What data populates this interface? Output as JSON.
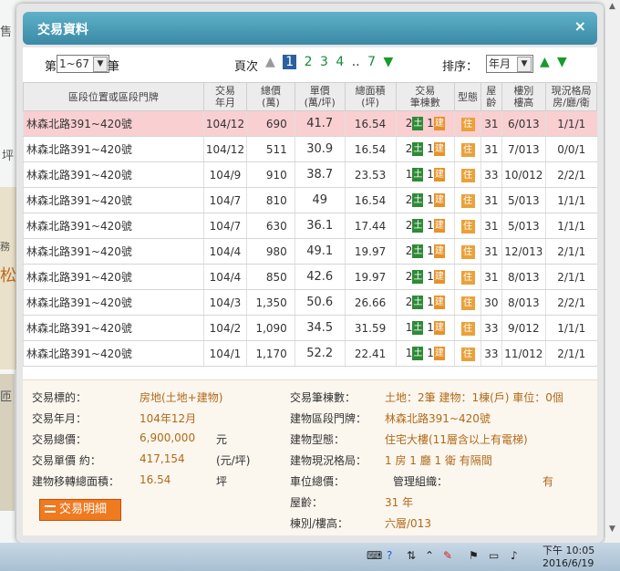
{
  "dialog": {
    "title": "交易資料",
    "close_symbol": "×"
  },
  "background": {
    "frag1": "售",
    "frag2": "坪",
    "frag3": "松",
    "frag4": "務",
    "frag5": "匝"
  },
  "controls": {
    "page_prefix": "第",
    "page_range": "1~67",
    "page_suffix": "筆",
    "pages_label": "頁次",
    "pages": [
      "1",
      "2",
      "3",
      "4"
    ],
    "ellipsis": "..",
    "last_page": "7",
    "sort_label": "排序：",
    "sort_value": "年月"
  },
  "table": {
    "headers": {
      "addr": "區段位置或區段門牌",
      "ym": [
        "交易",
        "年月"
      ],
      "total": [
        "總價",
        "(萬)"
      ],
      "unit": [
        "單價",
        "(萬/坪)"
      ],
      "area": [
        "總面積",
        "(坪)"
      ],
      "count": [
        "交易",
        "筆棟數"
      ],
      "type": "型態",
      "age": [
        "屋",
        "齡"
      ],
      "floor": [
        "樓別",
        "樓高"
      ],
      "layout": [
        "現況格局",
        "房/廳/衛"
      ]
    },
    "tags": {
      "land": "土",
      "building": "建",
      "residential": "住"
    },
    "rows": [
      {
        "addr": "林森北路391~420號",
        "ym": "104/12",
        "total": "690",
        "unit": "41.7",
        "area": "16.54",
        "land": "2",
        "bld": "1",
        "age": "31",
        "floor": "6/013",
        "layout": "1/1/1",
        "highlight": true
      },
      {
        "addr": "林森北路391~420號",
        "ym": "104/12",
        "total": "511",
        "unit": "30.9",
        "area": "16.54",
        "land": "2",
        "bld": "1",
        "age": "31",
        "floor": "7/013",
        "layout": "0/0/1"
      },
      {
        "addr": "林森北路391~420號",
        "ym": "104/9",
        "total": "910",
        "unit": "38.7",
        "area": "23.53",
        "land": "1",
        "bld": "1",
        "age": "33",
        "floor": "10/012",
        "layout": "2/2/1"
      },
      {
        "addr": "林森北路391~420號",
        "ym": "104/7",
        "total": "810",
        "unit": "49",
        "area": "16.54",
        "land": "2",
        "bld": "1",
        "age": "31",
        "floor": "5/013",
        "layout": "1/1/1"
      },
      {
        "addr": "林森北路391~420號",
        "ym": "104/7",
        "total": "630",
        "unit": "36.1",
        "area": "17.44",
        "land": "2",
        "bld": "1",
        "age": "31",
        "floor": "5/013",
        "layout": "1/1/1"
      },
      {
        "addr": "林森北路391~420號",
        "ym": "104/4",
        "total": "980",
        "unit": "49.1",
        "area": "19.97",
        "land": "2",
        "bld": "1",
        "age": "31",
        "floor": "12/013",
        "layout": "2/1/1"
      },
      {
        "addr": "林森北路391~420號",
        "ym": "104/4",
        "total": "850",
        "unit": "42.6",
        "area": "19.97",
        "land": "2",
        "bld": "1",
        "age": "31",
        "floor": "8/013",
        "layout": "2/1/1"
      },
      {
        "addr": "林森北路391~420號",
        "ym": "104/3",
        "total": "1,350",
        "unit": "50.6",
        "area": "26.66",
        "land": "2",
        "bld": "1",
        "age": "30",
        "floor": "8/013",
        "layout": "2/2/1"
      },
      {
        "addr": "林森北路391~420號",
        "ym": "104/2",
        "total": "1,090",
        "unit": "34.5",
        "area": "31.59",
        "land": "1",
        "bld": "1",
        "age": "33",
        "floor": "9/012",
        "layout": "1/1/1"
      },
      {
        "addr": "林森北路391~420號",
        "ym": "104/1",
        "total": "1,170",
        "unit": "52.2",
        "area": "22.41",
        "land": "1",
        "bld": "1",
        "age": "33",
        "floor": "11/012",
        "layout": "2/1/1"
      }
    ]
  },
  "detail": {
    "target_label": "交易標的：",
    "target_value": "房地(土地+建物)",
    "ym_label": "交易年月：",
    "ym_value": "104年12月",
    "total_label": "交易總價：",
    "total_value": "6,900,000",
    "total_unit": "元",
    "unit_label": "交易單價 約：",
    "unit_value": "417,154",
    "unit_unit": "(元/坪)",
    "area_label": "建物移轉總面積：",
    "area_value": "16.54",
    "area_unit": "坪",
    "count_label": "交易筆棟數：",
    "count_value": "土地：2筆 建物：1棟(戶) 車位：0個",
    "addr_label": "建物區段門牌：",
    "addr_value": "林森北路391~420號",
    "type_label": "建物型態：",
    "type_value": "住宅大樓(11層含以上有電梯)",
    "layout_label": "建物現況格局：",
    "layout_value": "1 房 1 廳 1 衛 有隔間",
    "parking_label": "車位總價：",
    "mgmt_label": "管理組織：",
    "mgmt_value": "有",
    "age_label": "屋齡：",
    "age_value": "31 年",
    "floor_label": "棟別/樓高：",
    "floor_value": "六層/013",
    "button_label": "交易明細"
  },
  "taskbar": {
    "time": "下午 10:05",
    "date": "2016/6/19"
  }
}
